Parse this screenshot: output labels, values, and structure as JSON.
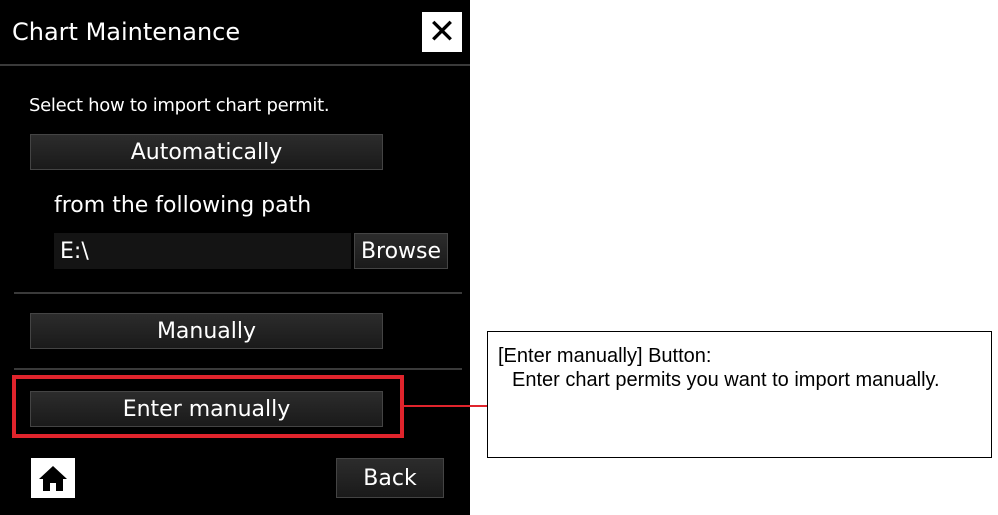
{
  "dialog": {
    "title": "Chart Maintenance",
    "close_icon": "close-icon",
    "prompt": "Select how to import chart permit.",
    "automatic_button": "Automatically",
    "path_label": "from the following path",
    "path_value": "E:\\",
    "browse_button": "Browse",
    "manual_button": "Manually",
    "enter_manually_button": "Enter manually",
    "home_icon": "home-icon",
    "back_button": "Back"
  },
  "annotation": {
    "heading": "[Enter manually] Button:",
    "description": "Enter chart permits you want to import manually.",
    "highlight_color": "#e0242c"
  }
}
